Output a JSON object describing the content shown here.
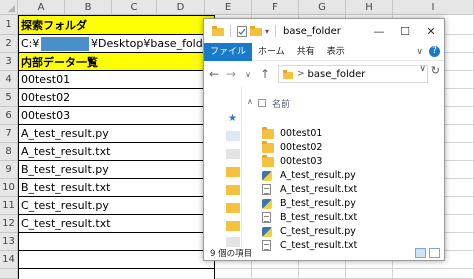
{
  "sheet": {
    "columns": [
      "A",
      "B",
      "C",
      "D",
      "E",
      "F",
      "G",
      "H",
      "I"
    ],
    "rows": [
      "1",
      "2",
      "3",
      "4",
      "5",
      "6",
      "7",
      "8",
      "9",
      "10",
      "11",
      "12",
      "13",
      "14"
    ],
    "table": {
      "header_label": "探索フォルダ",
      "path_prefix": "C:¥",
      "path_suffix": "¥Desktop¥base_folder",
      "list_header": "内部データ一覧",
      "items": [
        "00test01",
        "00test02",
        "00test03",
        "A_test_result.py",
        "A_test_result.txt",
        "B_test_result.py",
        "B_test_result.txt",
        "C_test_result.py",
        "C_test_result.txt"
      ]
    },
    "colors": {
      "header_fill": "#ffff00",
      "mask": "#4a8fc9"
    }
  },
  "explorer": {
    "title": "base_folder",
    "window_buttons": {
      "minimize": "—",
      "maximize": "☐",
      "close": "✕"
    },
    "ribbon_tabs": [
      "ファイル",
      "ホーム",
      "共有",
      "表示"
    ],
    "ribbon_chevron": "∨",
    "help": "?",
    "nav": {
      "back": "←",
      "forward": "→",
      "dropdown": "∨",
      "up": "↑"
    },
    "address": {
      "folder": "base_folder",
      "separator": ">",
      "dropdown": "∨",
      "refresh": "↻"
    },
    "column_name": "名前",
    "files": [
      {
        "name": "00test01",
        "icon": "folder-icon"
      },
      {
        "name": "00test02",
        "icon": "folder-icon"
      },
      {
        "name": "00test03",
        "icon": "folder-icon"
      },
      {
        "name": "A_test_result.py",
        "icon": "python-file-icon"
      },
      {
        "name": "A_test_result.txt",
        "icon": "text-file-icon"
      },
      {
        "name": "B_test_result.py",
        "icon": "python-file-icon"
      },
      {
        "name": "B_test_result.txt",
        "icon": "text-file-icon"
      },
      {
        "name": "C_test_result.py",
        "icon": "python-file-icon"
      },
      {
        "name": "C_test_result.txt",
        "icon": "text-file-icon"
      }
    ],
    "status_text": "9 個の項目",
    "accent": "#1979ca"
  }
}
